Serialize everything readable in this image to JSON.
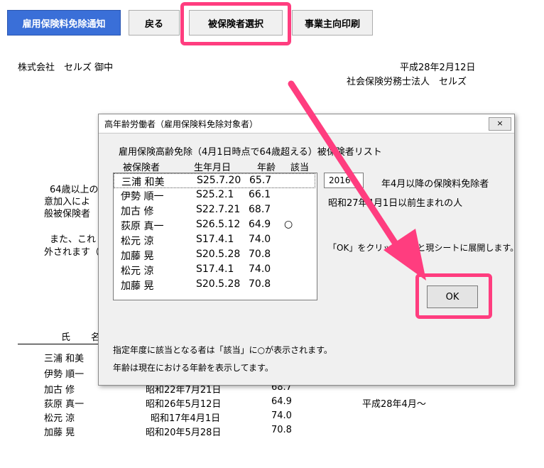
{
  "toolbar": {
    "notice_button": "雇用保険料免除通知",
    "back_button": "戻る",
    "select_button": "被保険者選択",
    "print_button": "事業主向印刷"
  },
  "sheet": {
    "recipient": "株式会社　セルズ 御中",
    "date": "平成28年2月12日",
    "sender": "社会保険労務士法人　セルズ",
    "body_lines": [
      "64歳以上の",
      "意加入によ",
      "般被保険者"
    ],
    "note_lines": [
      "また、これ",
      "外されます（"
    ],
    "header_name": "氏",
    "header_name2": "名",
    "rows": [
      {
        "name": "三浦 和美",
        "birth": "",
        "age": "",
        "from": ""
      },
      {
        "name": "伊勢 順一",
        "birth": "",
        "age": "",
        "from": ""
      },
      {
        "name": "加古 修",
        "birth": "昭和22年7月21日",
        "age": "68.7",
        "from": ""
      },
      {
        "name": "荻原 真一",
        "birth": "昭和26年5月12日",
        "age": "64.9",
        "from": "平成28年4月～"
      },
      {
        "name": "松元 涼",
        "birth": "昭和17年4月1日",
        "age": "74.0",
        "from": ""
      },
      {
        "name": "加藤 晃",
        "birth": "昭和20年5月28日",
        "age": "70.8",
        "from": ""
      }
    ]
  },
  "dialog": {
    "title": "高年齢労働者（雇用保険料免除対象者）",
    "close_label": "×",
    "list_caption": "雇用保険高齢免除（4月1日時点で64歳超える）被保険者リスト",
    "col_name": "被保険者",
    "col_birth": "生年月日",
    "col_age": "年齢",
    "col_flag": "該当",
    "list": [
      {
        "name": "三浦 和美",
        "birth": "S25.7.20",
        "age": "65.7",
        "flag": ""
      },
      {
        "name": "伊勢 順一",
        "birth": "S25.2.1",
        "age": "66.1",
        "flag": ""
      },
      {
        "name": "加古 修",
        "birth": "S22.7.21",
        "age": "68.7",
        "flag": ""
      },
      {
        "name": "荻原 真一",
        "birth": "S26.5.12",
        "age": "64.9",
        "flag": "○"
      },
      {
        "name": "松元 涼",
        "birth": "S17.4.1",
        "age": "74.0",
        "flag": ""
      },
      {
        "name": "加藤 晃",
        "birth": "S20.5.28",
        "age": "70.8",
        "flag": ""
      },
      {
        "name": "松元 涼",
        "birth": "S17.4.1",
        "age": "74.0",
        "flag": ""
      },
      {
        "name": "加藤 晃",
        "birth": "S20.5.28",
        "age": "70.8",
        "flag": ""
      }
    ],
    "year_value": "2016",
    "year_suffix": "年4月以降の保険料免除者",
    "born_before": "昭和27年4月1日以前生まれの人",
    "ok_hint": "「OK」をクリックすると現シートに展開します。",
    "ok_button": "OK",
    "footnote1": "指定年度に該当となる者は「該当」に○が表示されます。",
    "footnote2": "年齢は現在における年齢を表示してます。"
  },
  "colors": {
    "highlight": "#ff3d7f",
    "arrow": "#ff3d7f",
    "primary_button": "#3a6fd8"
  }
}
